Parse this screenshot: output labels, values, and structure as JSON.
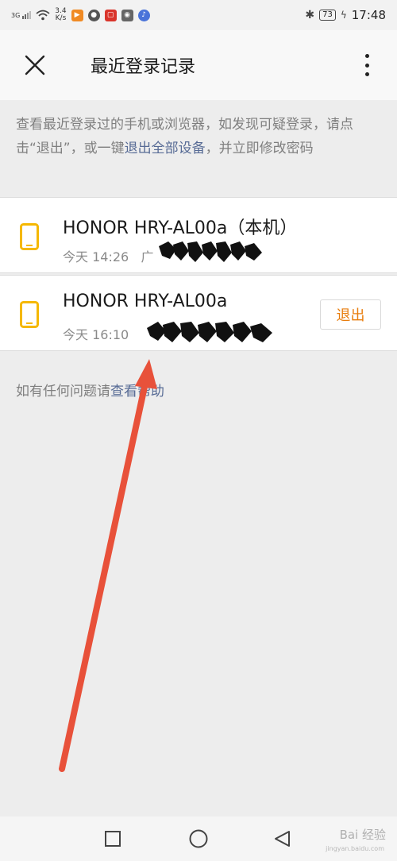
{
  "status_bar": {
    "network": "3G",
    "speed_value": "3.4",
    "speed_unit": "K/s",
    "battery": "73",
    "time": "17:48"
  },
  "header": {
    "title": "最近登录记录"
  },
  "description": {
    "text_before": "查看最近登录过的手机或浏览器，如发现可疑登录，请点击“退出”，或一键",
    "link": "退出全部设备",
    "text_after": "，并立即修改密码"
  },
  "devices": [
    {
      "name": "HONOR HRY-AL00a（本机）",
      "time": "今天 14:26",
      "location_partial": "广"
    },
    {
      "name": "HONOR HRY-AL00a",
      "time": "今天 16:10",
      "logout_label": "退出"
    }
  ],
  "help": {
    "text": "如有任何问题请",
    "link": "查看帮助"
  },
  "watermark": {
    "text": "Bai 经验",
    "sub": "jingyan.baidu.com"
  },
  "colors": {
    "accent_link": "#576b95",
    "logout_text": "#e87d0d",
    "phone_icon": "#f5b800",
    "arrow": "#e8513a"
  }
}
